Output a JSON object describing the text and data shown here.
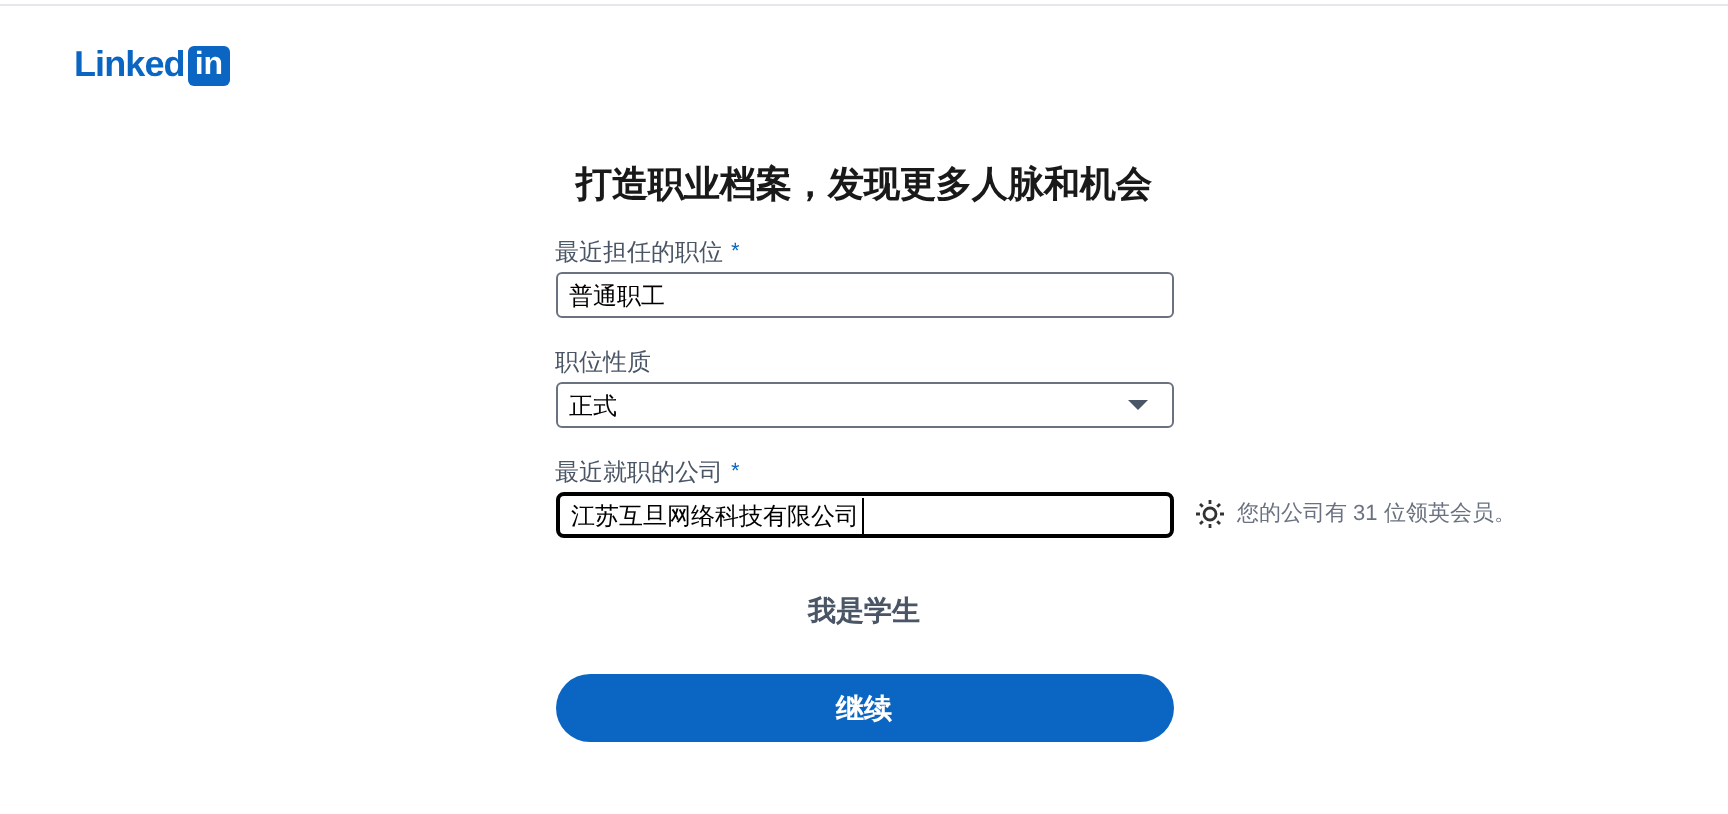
{
  "logo": {
    "wordmark": "Linked",
    "badge": "in"
  },
  "title": "打造职业档案，发现更多人脉和机会",
  "required_marker": "*",
  "fields": [
    {
      "kind": "text",
      "label": "最近担任的职位",
      "required": true,
      "value": "普通职工",
      "focused": false
    },
    {
      "kind": "select",
      "label": "职位性质",
      "required": false,
      "value": "正式",
      "focused": false
    },
    {
      "kind": "text",
      "label": "最近就职的公司",
      "required": true,
      "value": "江苏互旦网络科技有限公司",
      "focused": true,
      "hint": "您的公司有 31 位领英会员。"
    }
  ],
  "student_link": "我是学生",
  "continue_button": "继续"
}
